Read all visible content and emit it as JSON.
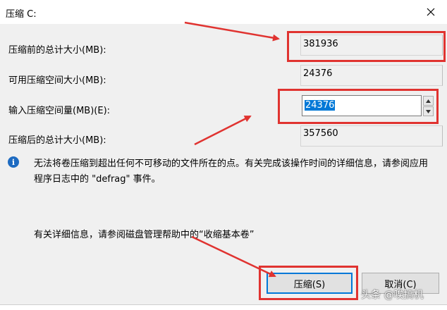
{
  "window": {
    "title": "压缩 C:"
  },
  "fields": [
    {
      "label": "压缩前的总计大小(MB):",
      "value": "381936"
    },
    {
      "label": "可用压缩空间大小(MB):",
      "value": "24376"
    },
    {
      "label": "输入压缩空间量(MB)(E):",
      "value": "24376"
    },
    {
      "label": "压缩后的总计大小(MB):",
      "value": "357560"
    }
  ],
  "info": {
    "message": "无法将卷压缩到超出任何不可移动的文件所在的点。有关完成该操作时间的详细信息，请参阅应用程序日志中的 \"defrag\" 事件。",
    "detail": "有关详细信息，请参阅磁盘管理帮助中的“收缩基本卷”"
  },
  "buttons": {
    "shrink": "压缩(S)",
    "cancel": "取消(C)"
  },
  "watermark": "头条 @唉搞机",
  "colors": {
    "annotation": "#e03330",
    "selection": "#0078d7",
    "info_icon": "#1e6bc1"
  },
  "icons": {
    "close": "close-icon",
    "info": "info-icon",
    "spin_up": "chevron-up-icon",
    "spin_down": "chevron-down-icon"
  }
}
